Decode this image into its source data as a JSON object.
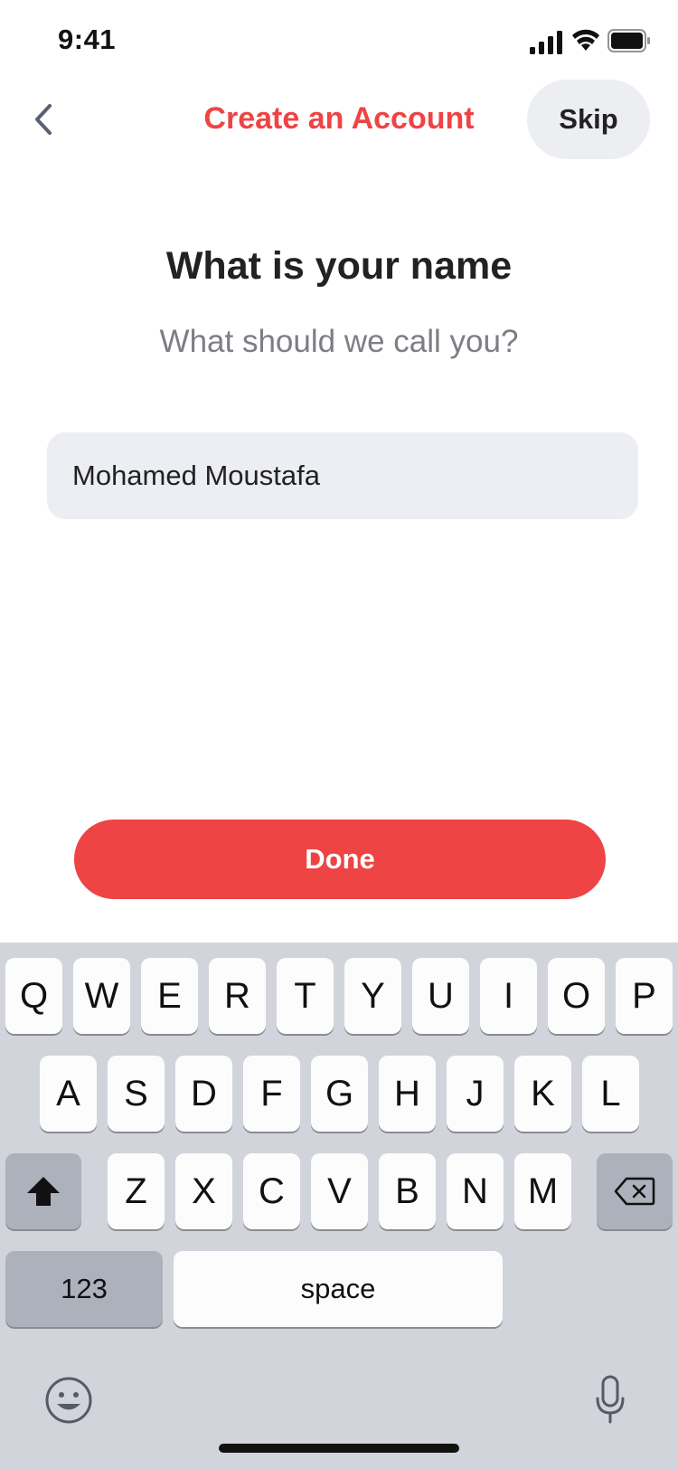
{
  "status_bar": {
    "time": "9:41"
  },
  "header": {
    "title": "Create an Account",
    "skip_label": "Skip"
  },
  "content": {
    "heading": "What is your name",
    "subheading": "What should we call you?",
    "name_value": "Mohamed Moustafa"
  },
  "actions": {
    "done_label": "Done"
  },
  "colors": {
    "accent": "#ee4444",
    "keyboard_bg": "#d2d4db",
    "field_bg": "#eceef3"
  },
  "keyboard": {
    "row1": [
      "Q",
      "W",
      "E",
      "R",
      "T",
      "Y",
      "U",
      "I",
      "O",
      "P"
    ],
    "row2": [
      "A",
      "S",
      "D",
      "F",
      "G",
      "H",
      "J",
      "K",
      "L"
    ],
    "row3": [
      "Z",
      "X",
      "C",
      "V",
      "B",
      "N",
      "M"
    ],
    "numbers_label": "123",
    "space_label": "space"
  }
}
